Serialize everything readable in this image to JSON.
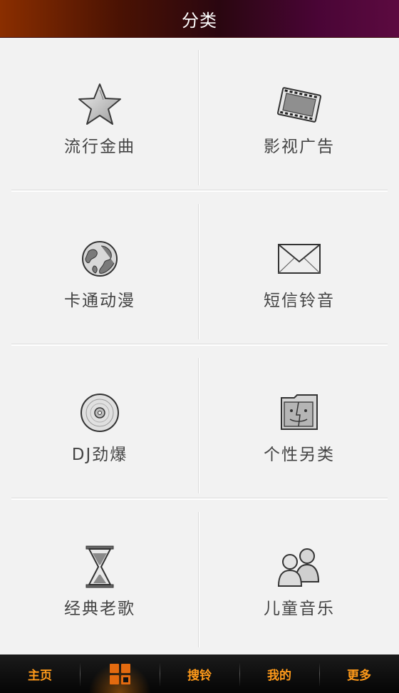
{
  "header": {
    "title": "分类"
  },
  "categories": [
    {
      "label": "流行金曲",
      "icon": "star-icon"
    },
    {
      "label": "影视广告",
      "icon": "film-icon"
    },
    {
      "label": "卡通动漫",
      "icon": "globe-icon"
    },
    {
      "label": "短信铃音",
      "icon": "envelope-icon"
    },
    {
      "label": "DJ劲爆",
      "icon": "disc-icon"
    },
    {
      "label": "个性另类",
      "icon": "finder-folder-icon"
    },
    {
      "label": "经典老歌",
      "icon": "hourglass-icon"
    },
    {
      "label": "儿童音乐",
      "icon": "people-icon"
    }
  ],
  "tabbar": {
    "items": [
      {
        "label": "主页"
      },
      {
        "label": "",
        "icon": "category-grid-icon",
        "active": true
      },
      {
        "label": "搜铃"
      },
      {
        "label": "我的"
      },
      {
        "label": "更多"
      }
    ]
  },
  "colors": {
    "accent": "#ff9a1a",
    "header_left": "#8a2e00",
    "header_right": "#5c0a40",
    "background": "#f2f2f2"
  }
}
